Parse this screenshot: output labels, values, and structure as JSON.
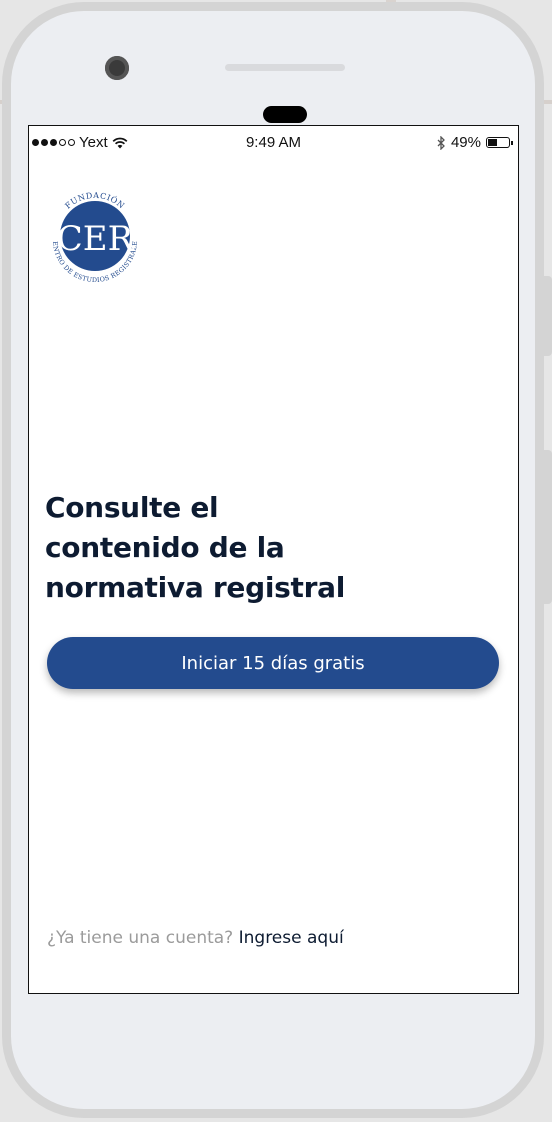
{
  "status_bar": {
    "carrier": "Yext",
    "time": "9:49 AM",
    "battery": "49%",
    "battery_level": 0.49,
    "signal_bars_filled": 3,
    "signal_bars_total": 5
  },
  "logo": {
    "initials": "CER",
    "ring_text_top": "FUNDACIÓN",
    "ring_text_bottom": "CENTRO DE ESTUDIOS REGISTRALES",
    "color": "#234b8e"
  },
  "hero": {
    "headline_lines": [
      "Consulte el",
      "contenido de la",
      "normativa registral"
    ]
  },
  "cta": {
    "label": "Iniciar 15 días gratis",
    "color": "#234b8e"
  },
  "login": {
    "question": "¿Ya tiene una cuenta?",
    "link": "Ingrese aquí"
  }
}
